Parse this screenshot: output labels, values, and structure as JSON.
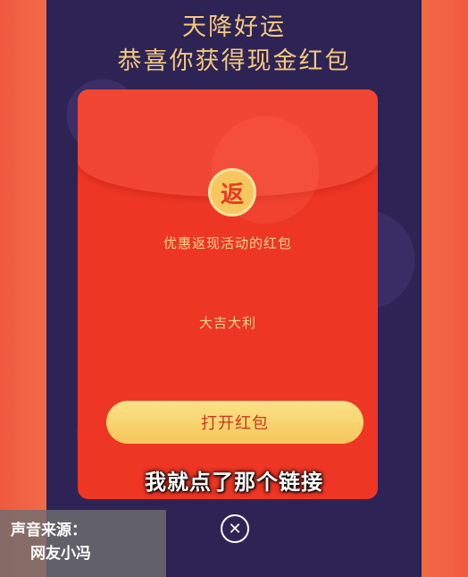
{
  "header": {
    "line1": "天降好运",
    "line2": "恭喜你获得现金红包"
  },
  "envelope": {
    "badge_char": "返",
    "subtitle": "优惠返现活动的红包",
    "blessing": "大吉大利",
    "open_label": "打开红包"
  },
  "caption": "我就点了那个链接",
  "close": {
    "icon": "close-icon",
    "glyph": "✕"
  },
  "source": {
    "line1": "声音来源：",
    "line2": "网友小冯"
  },
  "colors": {
    "background": "#f0503c",
    "phone_bg": "#2d2354",
    "envelope": "#ee3624",
    "gold_text": "#f3c97e",
    "button": "#f5c65a"
  }
}
